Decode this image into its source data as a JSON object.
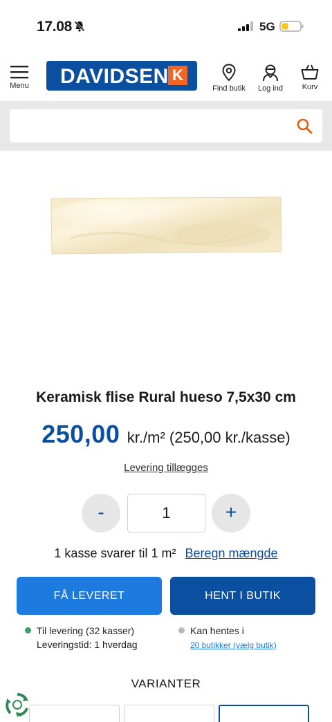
{
  "status_bar": {
    "time": "17.08",
    "network": "5G"
  },
  "header": {
    "menu_label": "Menu",
    "logo_text": "DAVIDSEN",
    "logo_k": "K",
    "find_store_label": "Find butik",
    "login_label": "Log ind",
    "cart_label": "Kurv"
  },
  "search": {
    "placeholder": ""
  },
  "product": {
    "title": "Keramisk flise Rural hueso 7,5x30 cm",
    "price": "250,00",
    "price_unit": "kr./m² (250,00 kr./kasse)",
    "delivery_link": "Levering tillægges"
  },
  "quantity": {
    "minus_label": "-",
    "value": "1",
    "plus_label": "+",
    "box_info": "1 kasse svarer til 1 m²",
    "calc_link": "Beregn mængde"
  },
  "buttons": {
    "deliver": "FÅ LEVERET",
    "pickup": "HENT I BUTIK"
  },
  "availability": {
    "delivery_line1": "Til levering (32 kasser)",
    "delivery_line2": "Leveringstid: 1 hverdag",
    "pickup_line1": "Kan hentes i",
    "pickup_link": "20 butikker (vælg butik)"
  },
  "variants": {
    "title": "VARIANTER"
  },
  "colors": {
    "brand_blue": "#0b4fa0",
    "button_blue": "#1d7be0",
    "accent_orange": "#f26522",
    "in_stock_green": "#3a9d6a"
  },
  "icons": [
    "bell-slash-icon",
    "signal-icon",
    "battery-icon",
    "hamburger-menu-icon",
    "location-pin-icon",
    "user-icon",
    "basket-icon",
    "search-icon",
    "recycle-icon"
  ]
}
